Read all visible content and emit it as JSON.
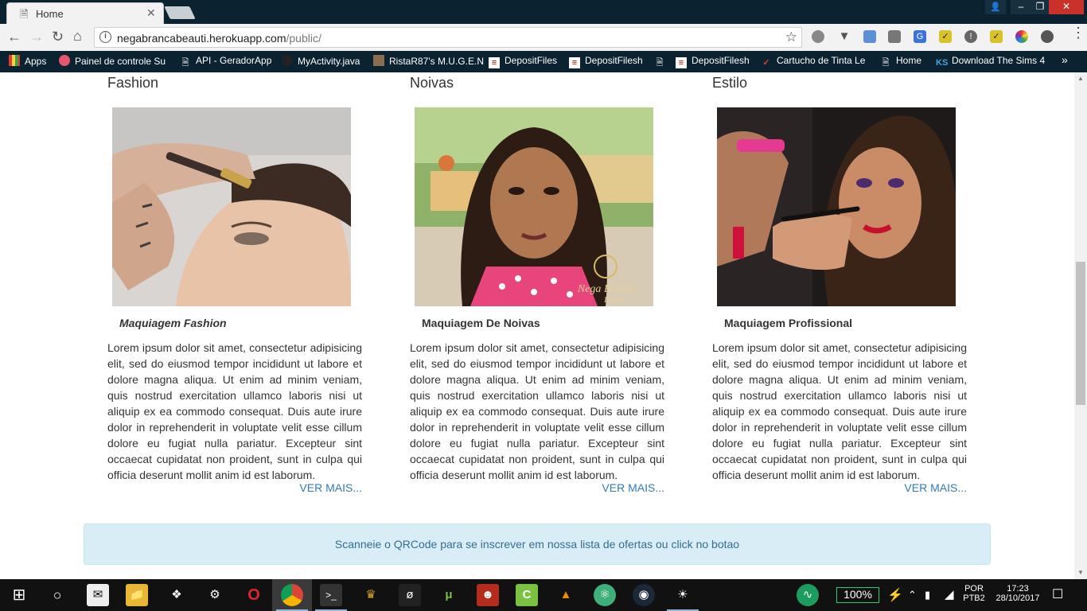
{
  "browser": {
    "tab_title": "Home",
    "url_host": "negabrancabeauti.herokuapp.com",
    "url_path": "/public/"
  },
  "bookmarks": [
    {
      "label": "Apps",
      "icon": "apps-grid-icon"
    },
    {
      "label": "Painel de controle Su",
      "icon": "panel-icon"
    },
    {
      "label": "API - GeradorApp",
      "icon": "page-icon"
    },
    {
      "label": "MyActivity.java",
      "icon": "github-icon"
    },
    {
      "label": "RistaR87's M.U.G.E.N",
      "icon": "mugen-icon"
    },
    {
      "label": "DepositFiles",
      "icon": "depositfiles-icon"
    },
    {
      "label": "DepositFilesh",
      "icon": "depositfiles-icon"
    },
    {
      "label": "DepositFilesh",
      "icon": "page-icon"
    },
    {
      "label": "Cartucho de Tinta Le",
      "icon": "check-icon"
    },
    {
      "label": "Home",
      "icon": "page-icon"
    },
    {
      "label": "Download The Sims 4",
      "icon": "ks-icon"
    }
  ],
  "columns": [
    {
      "heading": "Fashion",
      "subtitle": "Maquiagem Fashion",
      "body": "Lorem ipsum dolor sit amet, consectetur adipisicing elit, sed do eiusmod tempor incididunt ut labore et dolore magna aliqua. Ut enim ad minim veniam, quis nostrud exercitation ullamco laboris nisi ut aliquip ex ea commodo consequat. Duis aute irure dolor in reprehenderit in voluptate velit esse cillum dolore eu fugiat nulla pariatur. Excepteur sint occaecat cupidatat non proident, sunt in culpa qui officia deserunt mollit anim id est laborum.",
      "more": "VER MAIS..."
    },
    {
      "heading": "Noivas",
      "subtitle": "Maquiagem De Noivas",
      "body": "Lorem ipsum dolor sit amet, consectetur adipisicing elit, sed do eiusmod tempor incididunt ut labore et dolore magna aliqua. Ut enim ad minim veniam, quis nostrud exercitation ullamco laboris nisi ut aliquip ex ea commodo consequat. Duis aute irure dolor in reprehenderit in voluptate velit esse cillum dolore eu fugiat nulla pariatur. Excepteur sint occaecat cupidatat non proident, sunt in culpa qui officia deserunt mollit anim id est laborum.",
      "more": "VER MAIS...",
      "watermark_line1": "Nega Branca",
      "watermark_line2": "Beauty"
    },
    {
      "heading": "Estilo",
      "subtitle": "Maquiagem Profissional",
      "body": "Lorem ipsum dolor sit amet, consectetur adipisicing elit, sed do eiusmod tempor incididunt ut labore et dolore magna aliqua. Ut enim ad minim veniam, quis nostrud exercitation ullamco laboris nisi ut aliquip ex ea commodo consequat. Duis aute irure dolor in reprehenderit in voluptate velit esse cillum dolore eu fugiat nulla pariatur. Excepteur sint occaecat cupidatat non proident, sunt in culpa qui officia deserunt mollit anim id est laborum.",
      "more": "VER MAIS..."
    }
  ],
  "alert_text": "Scanneie o QRCode para se inscrever em nossa lista de ofertas ou click no botao",
  "taskbar": {
    "battery": "100%",
    "lang_line1": "POR",
    "lang_line2": "PTB2",
    "time": "17:23",
    "date": "28/10/2017"
  },
  "colors": {
    "chrome_dark": "#0b2230",
    "link": "#337ab7",
    "alert_bg": "#d9edf7",
    "alert_text": "#31708f"
  }
}
